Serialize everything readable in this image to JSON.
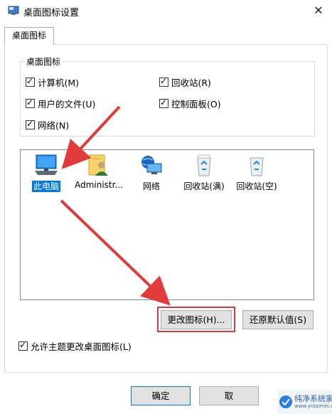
{
  "window": {
    "title": "桌面图标设置",
    "close_symbol": "✕"
  },
  "tab": {
    "label": "桌面图标"
  },
  "group": {
    "title": "桌面图标",
    "checkboxes": [
      {
        "label": "计算机(M)",
        "checked": true
      },
      {
        "label": "回收站(R)",
        "checked": true
      },
      {
        "label": "用户的文件(U)",
        "checked": true
      },
      {
        "label": "控制面板(O)",
        "checked": true
      },
      {
        "label": "网络(N)",
        "checked": true
      }
    ]
  },
  "icons": [
    {
      "label": "此电脑",
      "icon": "computer-icon",
      "selected": true
    },
    {
      "label": "Administr...",
      "icon": "user-folder-icon",
      "selected": false
    },
    {
      "label": "网络",
      "icon": "network-icon",
      "selected": false
    },
    {
      "label": "回收站(满)",
      "icon": "recycle-bin-full-icon",
      "selected": false
    },
    {
      "label": "回收站(空)",
      "icon": "recycle-bin-empty-icon",
      "selected": false
    }
  ],
  "buttons": {
    "change_icon": "更改图标(H)...",
    "restore_default": "还原默认值(S)",
    "ok": "确定",
    "cancel": "取"
  },
  "allow_themes": {
    "label": "允许主题更改桌面图标(L)",
    "checked": true
  },
  "colors": {
    "selection": "#0078d7",
    "annotation": "#e03a3a"
  },
  "watermark": {
    "text": "纯净系统家园",
    "url": "www.yidaimei.com"
  }
}
